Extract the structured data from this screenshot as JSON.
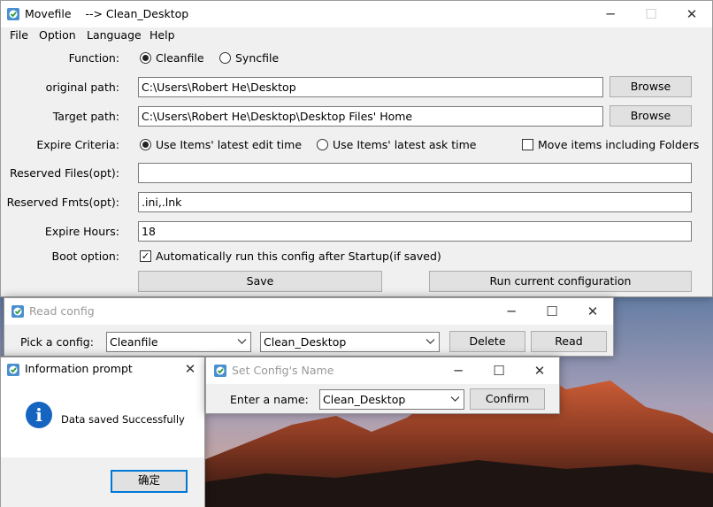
{
  "main": {
    "title": "Movefile    --> Clean_Desktop",
    "menu": [
      "File",
      "Option",
      "Language",
      "Help"
    ],
    "function_label": "Function:",
    "function_options": [
      "Cleanfile",
      "Syncfile"
    ],
    "function_selected": "Cleanfile",
    "original_path_label": "original path:",
    "original_path_value": "C:\\Users\\Robert He\\Desktop",
    "target_path_label": "Target path:",
    "target_path_value": "C:\\Users\\Robert He\\Desktop\\Desktop Files' Home",
    "browse_label": "Browse",
    "expire_criteria_label": "Expire Criteria:",
    "expire_options": [
      "Use Items' latest edit time",
      "Use Items' latest ask time"
    ],
    "expire_selected": "Use Items' latest edit time",
    "move_folders_label": "Move items including Folders",
    "move_folders_checked": false,
    "reserved_files_label": "Reserved Files(opt):",
    "reserved_files_value": "",
    "reserved_fmts_label": "Reserved Fmts(opt):",
    "reserved_fmts_value": ".ini,.lnk",
    "expire_hours_label": "Expire Hours:",
    "expire_hours_value": "18",
    "boot_option_label": "Boot option:",
    "boot_option_text": "Automatically run this config after Startup(if saved)",
    "boot_option_checked": true,
    "save_label": "Save",
    "run_label": "Run current configuration"
  },
  "read_config": {
    "title": "Read config",
    "pick_label": "Pick a config:",
    "config_type": "Cleanfile",
    "config_name": "Clean_Desktop",
    "delete_label": "Delete",
    "read_label": "Read"
  },
  "info_prompt": {
    "title": "Information prompt",
    "message": "Data saved Successfully",
    "ok_label": "确定"
  },
  "set_name": {
    "title": "Set Config's Name",
    "enter_label": "Enter a name:",
    "name_value": "Clean_Desktop",
    "confirm_label": "Confirm"
  },
  "icons": {
    "minimize": "─",
    "maximize": "☐",
    "close": "✕",
    "checkmark": "✓",
    "info": "i"
  },
  "colors": {
    "accent": "#0078d7",
    "info_icon": "#1565c0",
    "window_bg": "#f0f0f0"
  }
}
